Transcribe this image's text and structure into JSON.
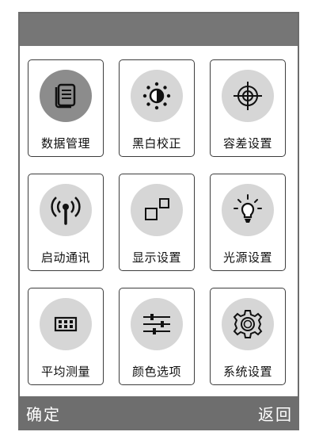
{
  "tiles": [
    {
      "label": "数据管理",
      "icon": "document-list-icon",
      "selected": true
    },
    {
      "label": "黑白校正",
      "icon": "brightness-icon",
      "selected": false
    },
    {
      "label": "容差设置",
      "icon": "crosshair-target-icon",
      "selected": false
    },
    {
      "label": "启动通讯",
      "icon": "wireless-antenna-icon",
      "selected": false
    },
    {
      "label": "显示设置",
      "icon": "display-squares-icon",
      "selected": false
    },
    {
      "label": "光源设置",
      "icon": "light-bulb-icon",
      "selected": false
    },
    {
      "label": "平均测量",
      "icon": "grid-keypad-icon",
      "selected": false
    },
    {
      "label": "颜色选项",
      "icon": "sliders-icon",
      "selected": false
    },
    {
      "label": "系统设置",
      "icon": "gear-icon",
      "selected": false
    }
  ],
  "softkeys": {
    "left": "确定",
    "right": "返回"
  },
  "colors": {
    "title_bar": "#767676",
    "bottom_bar": "#6e6e6e",
    "icon_circle": "#d6d6d6",
    "icon_circle_selected": "#8c8c8c",
    "tile_border": "#3d3d3d"
  }
}
